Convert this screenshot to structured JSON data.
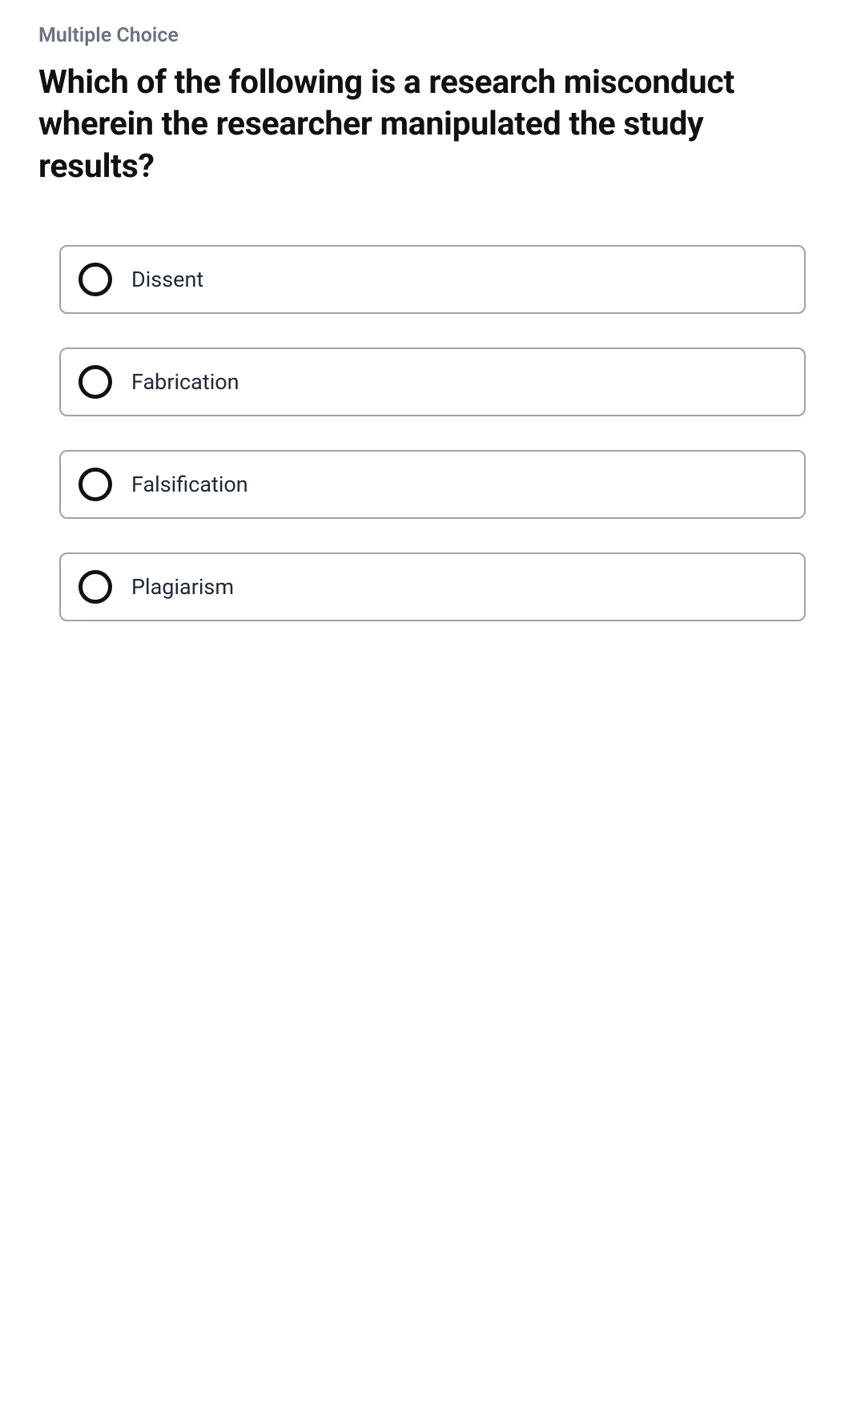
{
  "question_type": "Multiple Choice",
  "question_text": "Which of the following is a research misconduct wherein the researcher manipulated the study results?",
  "options": [
    {
      "label": "Dissent"
    },
    {
      "label": "Fabrication"
    },
    {
      "label": "Falsification"
    },
    {
      "label": "Plagiarism"
    }
  ]
}
